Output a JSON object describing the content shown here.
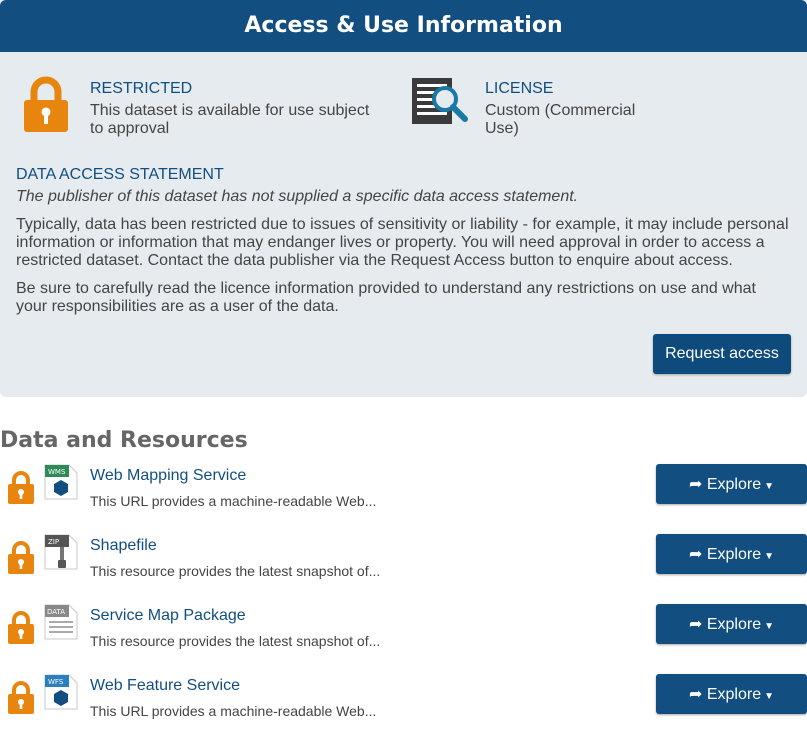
{
  "panel": {
    "title": "Access & Use Information",
    "restricted": {
      "title": "RESTRICTED",
      "desc_line1": "This dataset is available for use subject",
      "desc_line2": "to approval"
    },
    "license": {
      "title": "LICENSE",
      "desc_line1": "Custom (Commercial",
      "desc_line2": "Use)"
    },
    "data_access_statement_title": "DATA ACCESS STATEMENT",
    "data_access_statement_italic": "The publisher of this dataset has not supplied a specific data access statement.",
    "para1": [
      "Typically, data has been restricted due to issues of sensitivity or liability - for example, it may include personal",
      "information or information that may endanger lives or property. You will need approval in order to access a",
      "restricted dataset. Contact the data publisher via the Request Access button to enquire about access."
    ],
    "para2": [
      "Be sure to carefully read the licence information provided to understand any restrictions on use and what",
      "your responsibilities are as a user of the data."
    ],
    "request_button": "Request access"
  },
  "resources_title": "Data and Resources",
  "resources": [
    {
      "name": "Web Mapping Service",
      "desc": "This URL provides a machine-readable Web...",
      "file_label": "WMS",
      "icon": "wms-file-icon"
    },
    {
      "name": "Shapefile",
      "desc": "This resource provides the latest snapshot of...",
      "file_label": "ZIP",
      "icon": "zip-file-icon"
    },
    {
      "name": "Service Map Package",
      "desc": "This resource provides the latest snapshot of...",
      "file_label": "DATA",
      "icon": "data-file-icon"
    },
    {
      "name": "Web Feature Service",
      "desc": "This URL provides a machine-readable Web...",
      "file_label": "WFS",
      "icon": "wfs-file-icon"
    }
  ],
  "explore_label": "Explore",
  "colors": {
    "header": "#124e80",
    "panel_bg": "#e6ebef",
    "lock_orange": "#e8850f",
    "link_blue": "#124e80"
  }
}
